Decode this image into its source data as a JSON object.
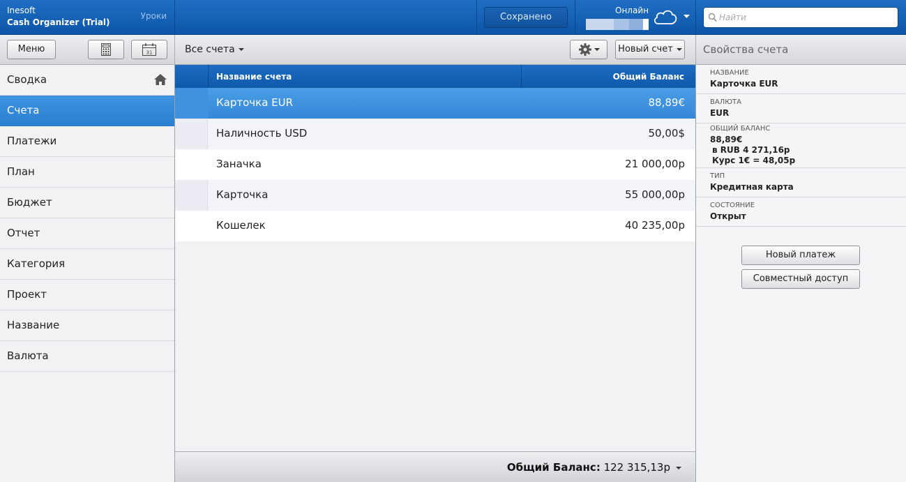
{
  "brand": {
    "company": "Inesoft",
    "product": "Cash Organizer (Trial)",
    "lessons": "Уроки"
  },
  "topbar": {
    "saved": "Сохранено",
    "online": "Онлайн",
    "search_placeholder": "Найти"
  },
  "toolbar": {
    "menu": "Меню",
    "all_accounts": "Все счета",
    "new_account": "Новый счет",
    "props_title": "Свойства счета"
  },
  "nav": [
    {
      "label": "Сводка",
      "icon": "home-icon"
    },
    {
      "label": "Счета"
    },
    {
      "label": "Платежи"
    },
    {
      "label": "План"
    },
    {
      "label": "Бюджет"
    },
    {
      "label": "Отчет"
    },
    {
      "label": "Категория"
    },
    {
      "label": "Проект"
    },
    {
      "label": "Название"
    },
    {
      "label": "Валюта"
    }
  ],
  "table": {
    "col_name": "Название счета",
    "col_balance": "Общий Баланс",
    "rows": [
      {
        "name": "Карточка EUR",
        "balance": "88,89€",
        "selected": true
      },
      {
        "name": "Наличность USD",
        "balance": "50,00$"
      },
      {
        "name": "Заначка",
        "balance": "21 000,00р"
      },
      {
        "name": "Карточка",
        "balance": "55 000,00р"
      },
      {
        "name": "Кошелек",
        "balance": "40 235,00р"
      }
    ]
  },
  "footer": {
    "total_label": "Общий Баланс:",
    "total_value": "122 315,13р"
  },
  "props": {
    "name_label": "Название",
    "name_value": "Карточка EUR",
    "currency_label": "Валюта",
    "currency_value": "EUR",
    "balance_label": "Общий баланс",
    "balance_value": "88,89€",
    "balance_rub": "в RUB 4 271,16р",
    "balance_rate": "Курс 1€ = 48,05р",
    "type_label": "Тип",
    "type_value": "Кредитная карта",
    "state_label": "Состояние",
    "state_value": "Открыт",
    "new_payment": "Новый платеж",
    "share": "Совместный доступ"
  },
  "colors": {
    "accent_blue": "#1f6fc4",
    "selection_blue": "#3a8ddb"
  }
}
